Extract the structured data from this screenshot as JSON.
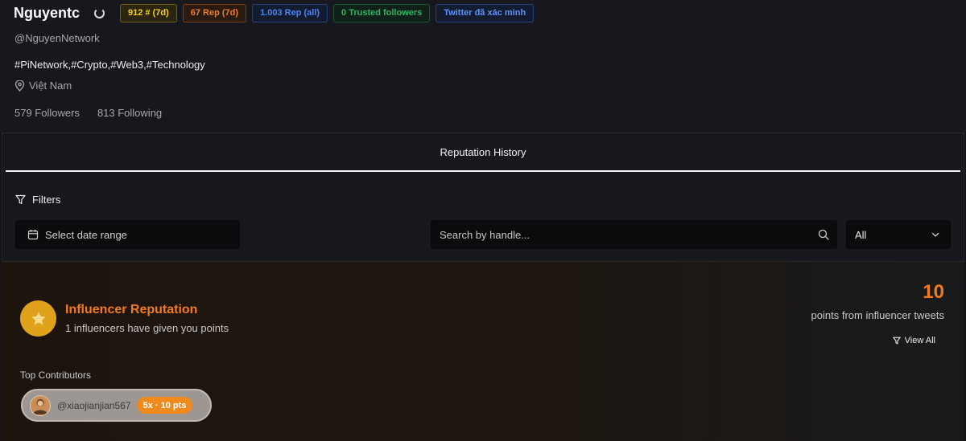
{
  "profile": {
    "name": "Nguyentc",
    "handle": "@NguyenNetwork",
    "bio": "#PiNetwork,#Crypto,#Web3,#Technology",
    "location": "Việt Nam",
    "followers": "579 Followers",
    "following": "813 Following",
    "badges": {
      "rank": "912 # (7d)",
      "rep_7d": "67 Rep (7d)",
      "rep_all": "1.003 Rep (all)",
      "trusted": "0 Trusted followers",
      "twitter": "Twitter đã xác minh"
    }
  },
  "reputation": {
    "tab_label": "Reputation History",
    "filters_label": "Filters",
    "date_range_label": "Select date range",
    "search_placeholder": "Search by handle...",
    "select_value": "All"
  },
  "influencer": {
    "title": "Influencer Reputation",
    "subtitle": "1 influencers have given you points",
    "points": "10",
    "points_label": "points from influencer tweets",
    "view_all_label": "View All",
    "top_contributors_label": "Top Contributors",
    "contributors": [
      {
        "handle": "@xiaojianjian567",
        "points": "5x · 10 pts"
      }
    ]
  },
  "colors": {
    "accent_orange": "#f27a1f",
    "badge_gold": "#f4cf2a",
    "badge_blue": "#4a84f3",
    "badge_green": "#2fb561",
    "background": "#131418"
  },
  "icons": [
    "spinner-icon",
    "location-pin-icon",
    "filter-icon",
    "calendar-icon",
    "search-icon",
    "chevron-down-icon",
    "star-icon",
    "user-avatar"
  ]
}
